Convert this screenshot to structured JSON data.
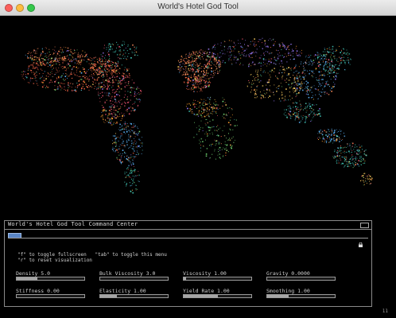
{
  "window": {
    "title": "World's Hotel God Tool"
  },
  "command_center": {
    "title": "World's Hotel God Tool Command Center",
    "hints": [
      "\"f\" to toggle fullscreen   \"tab\" to toggle this menu",
      "\"r\" to reset visualization"
    ],
    "sliders": [
      {
        "label": "Density 5.0",
        "value": 0.3
      },
      {
        "label": "Bulk Viscosity 3.0",
        "value": 0.0
      },
      {
        "label": "Viscosity 1.00",
        "value": 0.03
      },
      {
        "label": "Gravity 0.0000",
        "value": 0.0
      },
      {
        "label": "Stiffness 0.00",
        "value": 0.0
      },
      {
        "label": "Elasticity 1.00",
        "value": 0.25
      },
      {
        "label": "Yield Rate 1.00",
        "value": 0.5
      },
      {
        "label": "Smoothing 1.00",
        "value": 0.32
      }
    ]
  },
  "corner_counter": "11",
  "map_colors": [
    "#ff6a4a",
    "#ff8f5c",
    "#ff5b7a",
    "#46d2c2",
    "#5fb8ff",
    "#9c7cff",
    "#ffd060",
    "#78e07a",
    "#ff9f2f"
  ]
}
